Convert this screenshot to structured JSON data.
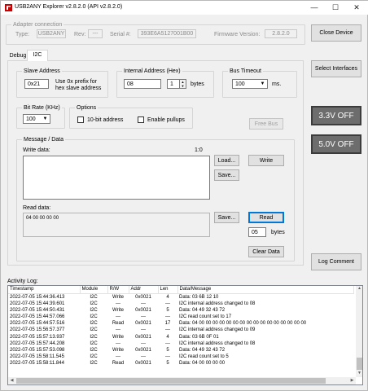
{
  "window": {
    "title": "USB2ANY Explorer v2.8.2.0  (API v2.8.2.0)"
  },
  "adapter": {
    "group_label": "Adapter connection",
    "type_label": "Type:",
    "type_value": "USB2ANY",
    "rev_label": "Rev:",
    "rev_value": "---",
    "serial_label": "Serial #:",
    "serial_value": "393E6A5127001B00",
    "fw_label": "Firmware Version:",
    "fw_value": "2.8.2.0"
  },
  "tabs": [
    "Debug",
    "I2C"
  ],
  "slave": {
    "group_label": "Slave Address",
    "value": "0x21",
    "hint_line1": "Use 0x prefix for",
    "hint_line2": "hex slave address"
  },
  "internal": {
    "group_label": "Internal Address (Hex)",
    "value": "08",
    "bytes_value": "1",
    "bytes_label": "bytes"
  },
  "timeout": {
    "group_label": "Bus Timeout",
    "value": "100",
    "unit": "ms."
  },
  "bitrate": {
    "group_label": "Bit Rate (KHz)",
    "value": "100"
  },
  "options": {
    "group_label": "Options",
    "ten_bit": "10-bit address",
    "pullups": "Enable pullups"
  },
  "free_bus": "Free Bus",
  "message": {
    "group_label": "Message / Data",
    "write_label": "Write data:",
    "write_pos": "1:0",
    "load": "Load...",
    "save": "Save...",
    "write": "Write",
    "read_label": "Read data:",
    "read_value": "04 00 00 00 00",
    "read_save": "Save...",
    "read": "Read",
    "read_count": "05",
    "bytes_label": "bytes",
    "clear": "Clear Data"
  },
  "right": {
    "close_device": "Close Device",
    "select_interfaces": "Select Interfaces",
    "v33": "3.3V OFF",
    "v50": "5.0V OFF",
    "log_comment": "Log Comment"
  },
  "activity": {
    "label": "Activity Log:",
    "columns": [
      "Timestamp",
      "Module",
      "R/W",
      "Addr",
      "Len",
      "Data/Message"
    ],
    "rows": [
      [
        "2022-07-05 15:44:36.413",
        "I2C",
        "Write",
        "0x0021",
        "4",
        "Data: 03 6B 12 10"
      ],
      [
        "2022-07-05 15:44:39.601",
        "I2C",
        "---",
        "---",
        "---",
        "I2C internal address changed to 08"
      ],
      [
        "2022-07-05 15:44:50.431",
        "I2C",
        "Write",
        "0x0021",
        "5",
        "Data: 04 49 32 43 72"
      ],
      [
        "2022-07-05 15:44:57.066",
        "I2C",
        "---",
        "---",
        "---",
        "I2C read count set to 17"
      ],
      [
        "2022-07-05 15:44:57.516",
        "I2C",
        "Read",
        "0x0021",
        "17",
        "Data: 04 00 00 00 00 00 00 00 00 00 00 00 00 00 00 00 00"
      ],
      [
        "2022-07-05 15:56:57.377",
        "I2C",
        "---",
        "---",
        "---",
        "I2C internal address changed to 09"
      ],
      [
        "2022-07-05 15:57:13.937",
        "I2C",
        "Write",
        "0x0021",
        "4",
        "Data: 03 6B 0F 01"
      ],
      [
        "2022-07-05 15:57:44.208",
        "I2C",
        "---",
        "---",
        "---",
        "I2C internal address changed to 08"
      ],
      [
        "2022-07-05 15:57:53.098",
        "I2C",
        "Write",
        "0x0021",
        "5",
        "Data: 04 49 32 43 72"
      ],
      [
        "2022-07-05 15:58:11.545",
        "I2C",
        "---",
        "---",
        "---",
        "I2C read count set to 5"
      ],
      [
        "2022-07-05 15:58:11.844",
        "I2C",
        "Read",
        "0x0021",
        "5",
        "Data: 04 00 00 00 00"
      ]
    ]
  }
}
